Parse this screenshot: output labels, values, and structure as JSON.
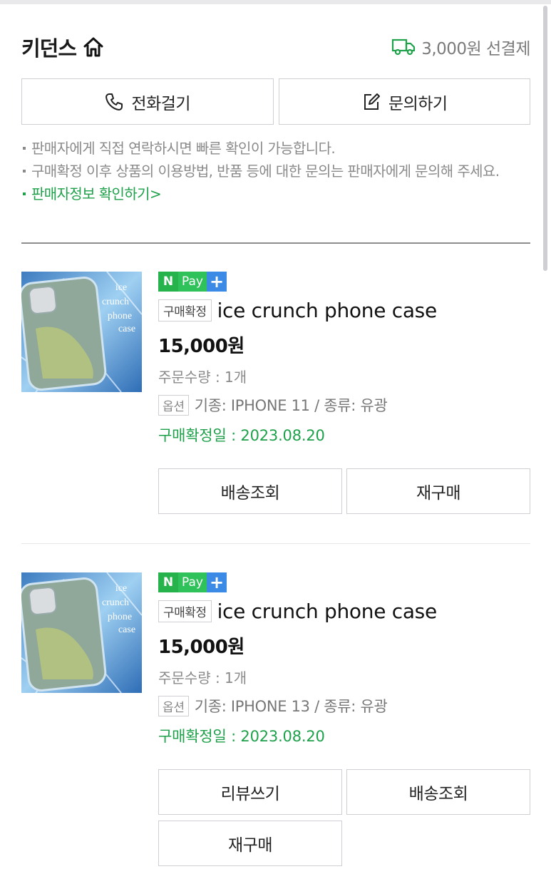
{
  "store": {
    "name": "키던스",
    "shipping": "3,000원 선결제"
  },
  "contact": {
    "call_label": "전화걸기",
    "inquiry_label": "문의하기"
  },
  "notes": {
    "line1": "판매자에게 직접 연락하시면 빠른 확인이 가능합니다.",
    "line2": "구매확정 이후 상품의 이용방법, 반품 등에 대한 문의는 판매자에게 문의해 주세요.",
    "seller_info_link": "판매자정보 확인하기>"
  },
  "colors": {
    "accent_green": "#1ea14a",
    "npay_green": "#2fc25b",
    "npay_blue": "#3a8ae6"
  },
  "orders": [
    {
      "npay_n": "N",
      "npay_pay": "Pay",
      "npay_plus": "+",
      "status": "구매확정",
      "product_name": "ice crunch phone case",
      "price": "15,000원",
      "quantity": "주문수량 : 1개",
      "option_badge": "옵션",
      "option": "기종: IPHONE 11 / 종류: 유광",
      "confirm_date": "구매확정일 : 2023.08.20",
      "thumb_text": [
        "ice",
        "crunch",
        "phone",
        "case"
      ],
      "buttons": [
        "배송조회",
        "재구매"
      ]
    },
    {
      "npay_n": "N",
      "npay_pay": "Pay",
      "npay_plus": "+",
      "status": "구매확정",
      "product_name": "ice crunch phone case",
      "price": "15,000원",
      "quantity": "주문수량 : 1개",
      "option_badge": "옵션",
      "option": "기종: IPHONE 13 / 종류: 유광",
      "confirm_date": "구매확정일 : 2023.08.20",
      "thumb_text": [
        "ice",
        "crunch",
        "phone",
        "case"
      ],
      "buttons": [
        "리뷰쓰기",
        "배송조회",
        "재구매"
      ]
    }
  ]
}
